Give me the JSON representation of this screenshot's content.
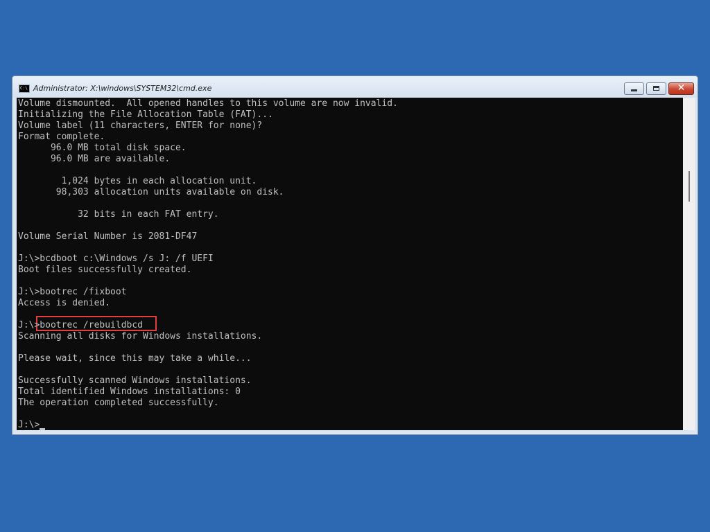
{
  "window": {
    "title": "Administrator: X:\\windows\\SYSTEM32\\cmd.exe",
    "app_icon_text": "C:\\"
  },
  "colors": {
    "desktop_bg": "#2d69b3",
    "console_bg": "#0c0c0c",
    "console_text": "#c0c0c0",
    "highlight_border": "#e04040"
  },
  "console": {
    "lines": [
      "Volume dismounted.  All opened handles to this volume are now invalid.",
      "Initializing the File Allocation Table (FAT)...",
      "Volume label (11 characters, ENTER for none)?",
      "Format complete.",
      "      96.0 MB total disk space.",
      "      96.0 MB are available.",
      "",
      "        1,024 bytes in each allocation unit.",
      "       98,303 allocation units available on disk.",
      "",
      "           32 bits in each FAT entry.",
      "",
      "Volume Serial Number is 2081-DF47",
      "",
      "J:\\>bcdboot c:\\Windows /s J: /f UEFI",
      "Boot files successfully created.",
      "",
      "J:\\>bootrec /fixboot",
      "Access is denied.",
      "",
      "J:\\>bootrec /rebuildbcd",
      "Scanning all disks for Windows installations.",
      "",
      "Please wait, since this may take a while...",
      "",
      "Successfully scanned Windows installations.",
      "Total identified Windows installations: 0",
      "The operation completed successfully.",
      "",
      "J:\\>"
    ],
    "highlighted_command": "bootrec /rebuildbcd"
  }
}
